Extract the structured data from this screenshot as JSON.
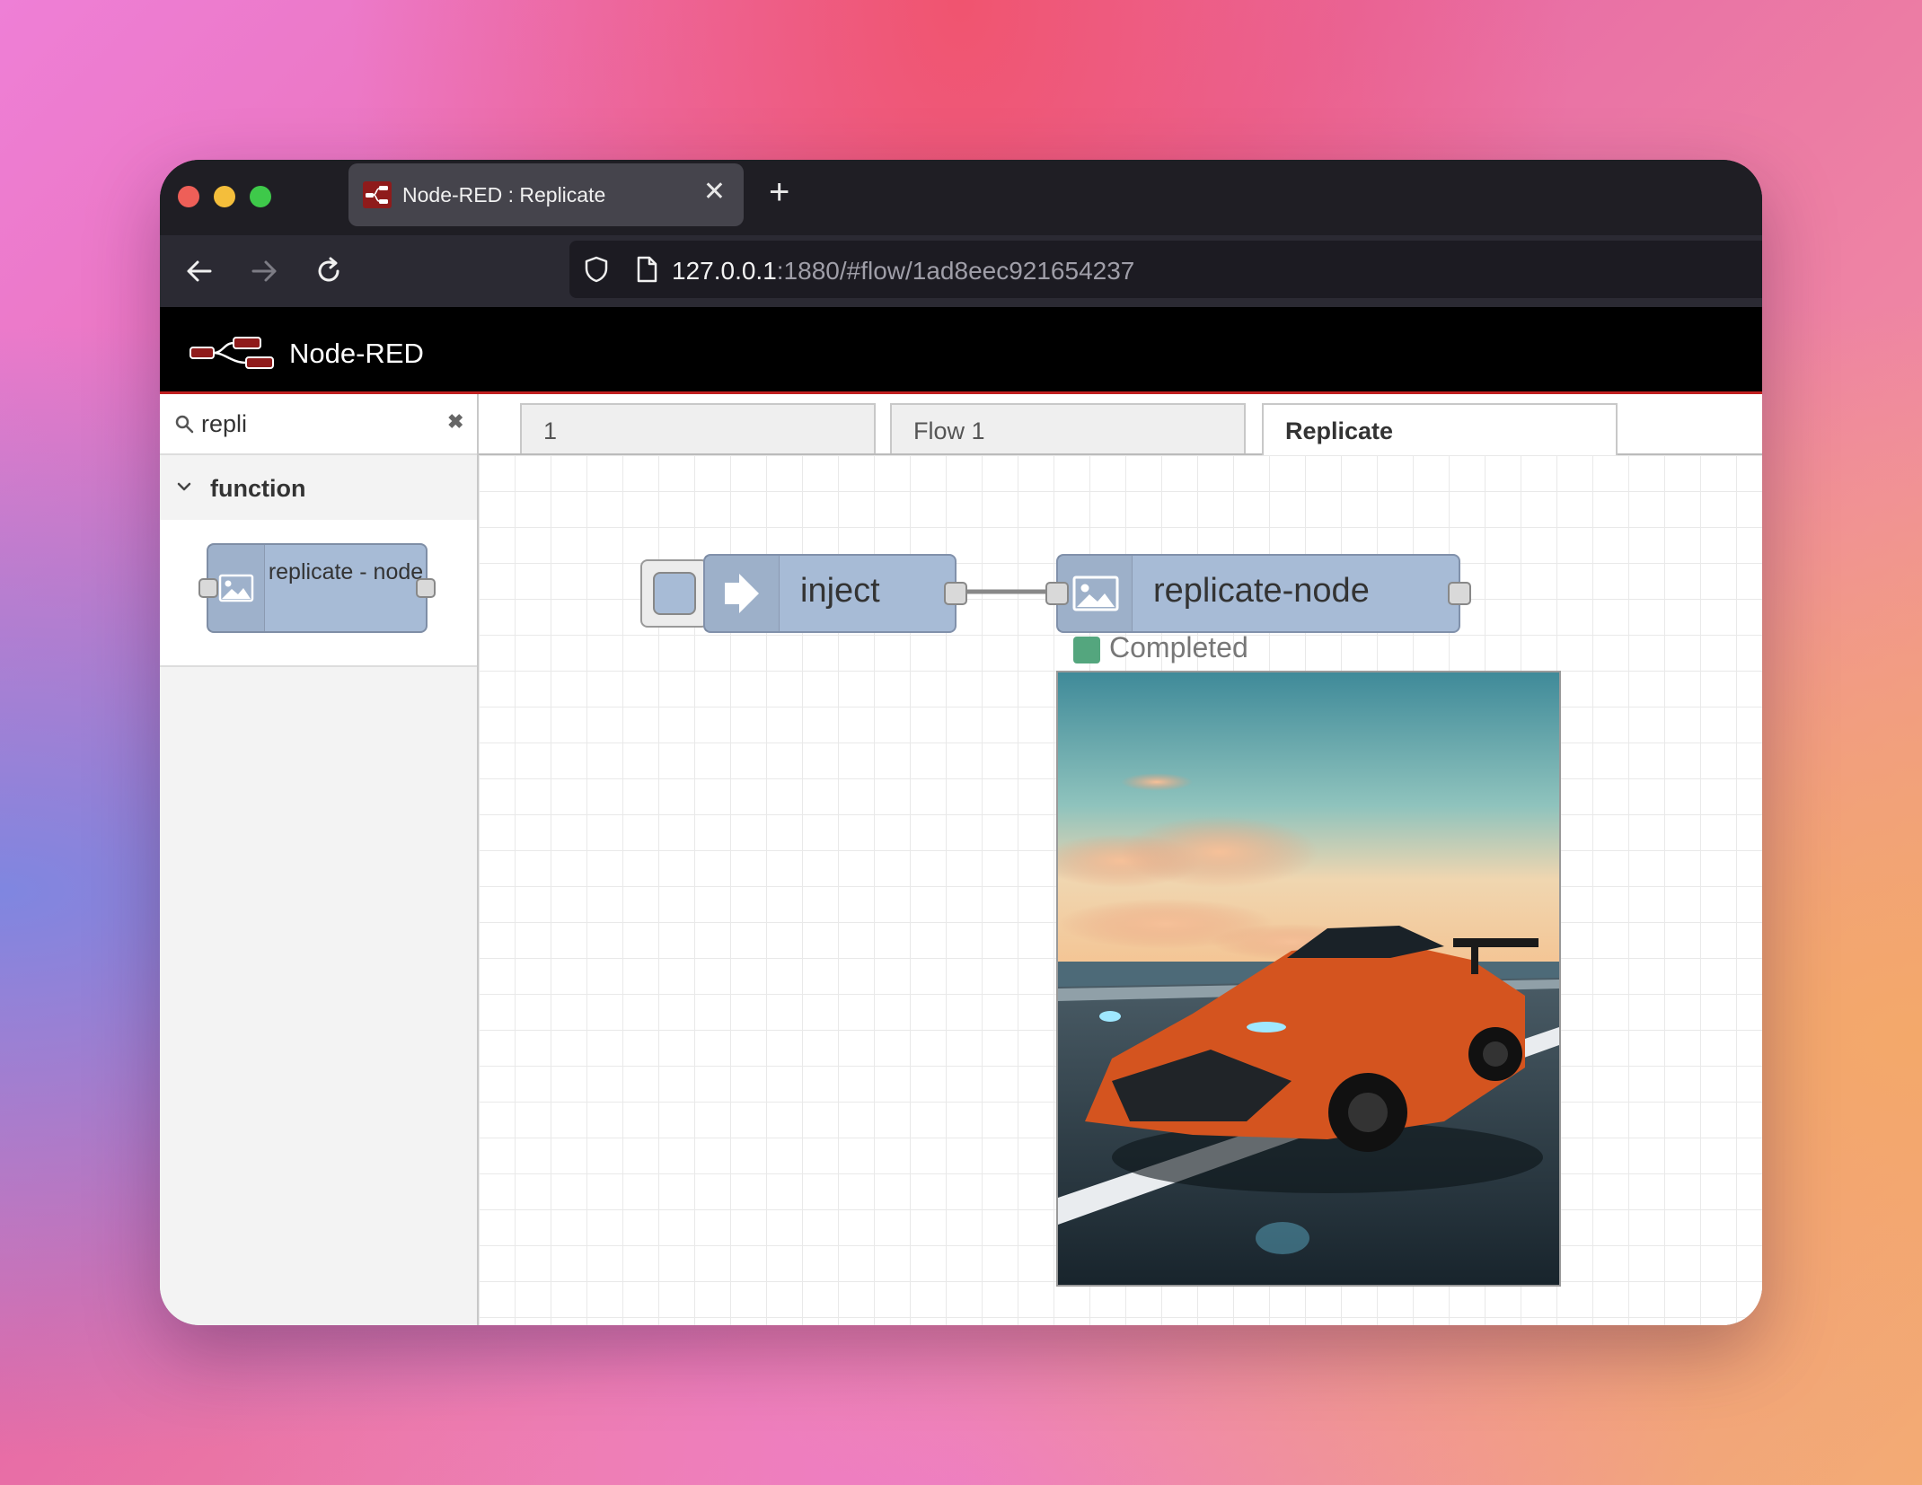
{
  "browser": {
    "tab_title": "Node-RED : Replicate",
    "tab_close": "✕",
    "new_tab": "+",
    "url_host": "127.0.0.1",
    "url_rest": ":1880/#flow/1ad8eec921654237"
  },
  "app": {
    "brand": "Node-RED"
  },
  "palette": {
    "search_value": "repli",
    "search_clear": "✖",
    "category": "function",
    "node_label": "replicate - node"
  },
  "workspace": {
    "tabs": [
      {
        "label": "1",
        "active": false
      },
      {
        "label": "Flow 1",
        "active": false
      },
      {
        "label": "Replicate",
        "active": true
      }
    ]
  },
  "flow": {
    "inject_label": "inject",
    "replicate_label": "replicate-node",
    "status_text": "Completed"
  },
  "colors": {
    "node_fill": "#a7bbd6",
    "header_accent": "#c02020",
    "status_ok": "#54a67e"
  }
}
